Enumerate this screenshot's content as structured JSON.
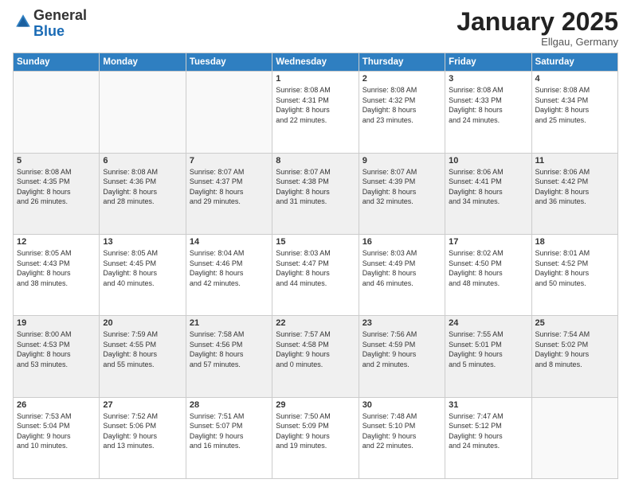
{
  "header": {
    "logo_line1": "General",
    "logo_line2": "Blue",
    "month": "January 2025",
    "location": "Ellgau, Germany"
  },
  "weekdays": [
    "Sunday",
    "Monday",
    "Tuesday",
    "Wednesday",
    "Thursday",
    "Friday",
    "Saturday"
  ],
  "weeks": [
    [
      {
        "day": "",
        "text": ""
      },
      {
        "day": "",
        "text": ""
      },
      {
        "day": "",
        "text": ""
      },
      {
        "day": "1",
        "text": "Sunrise: 8:08 AM\nSunset: 4:31 PM\nDaylight: 8 hours\nand 22 minutes."
      },
      {
        "day": "2",
        "text": "Sunrise: 8:08 AM\nSunset: 4:32 PM\nDaylight: 8 hours\nand 23 minutes."
      },
      {
        "day": "3",
        "text": "Sunrise: 8:08 AM\nSunset: 4:33 PM\nDaylight: 8 hours\nand 24 minutes."
      },
      {
        "day": "4",
        "text": "Sunrise: 8:08 AM\nSunset: 4:34 PM\nDaylight: 8 hours\nand 25 minutes."
      }
    ],
    [
      {
        "day": "5",
        "text": "Sunrise: 8:08 AM\nSunset: 4:35 PM\nDaylight: 8 hours\nand 26 minutes."
      },
      {
        "day": "6",
        "text": "Sunrise: 8:08 AM\nSunset: 4:36 PM\nDaylight: 8 hours\nand 28 minutes."
      },
      {
        "day": "7",
        "text": "Sunrise: 8:07 AM\nSunset: 4:37 PM\nDaylight: 8 hours\nand 29 minutes."
      },
      {
        "day": "8",
        "text": "Sunrise: 8:07 AM\nSunset: 4:38 PM\nDaylight: 8 hours\nand 31 minutes."
      },
      {
        "day": "9",
        "text": "Sunrise: 8:07 AM\nSunset: 4:39 PM\nDaylight: 8 hours\nand 32 minutes."
      },
      {
        "day": "10",
        "text": "Sunrise: 8:06 AM\nSunset: 4:41 PM\nDaylight: 8 hours\nand 34 minutes."
      },
      {
        "day": "11",
        "text": "Sunrise: 8:06 AM\nSunset: 4:42 PM\nDaylight: 8 hours\nand 36 minutes."
      }
    ],
    [
      {
        "day": "12",
        "text": "Sunrise: 8:05 AM\nSunset: 4:43 PM\nDaylight: 8 hours\nand 38 minutes."
      },
      {
        "day": "13",
        "text": "Sunrise: 8:05 AM\nSunset: 4:45 PM\nDaylight: 8 hours\nand 40 minutes."
      },
      {
        "day": "14",
        "text": "Sunrise: 8:04 AM\nSunset: 4:46 PM\nDaylight: 8 hours\nand 42 minutes."
      },
      {
        "day": "15",
        "text": "Sunrise: 8:03 AM\nSunset: 4:47 PM\nDaylight: 8 hours\nand 44 minutes."
      },
      {
        "day": "16",
        "text": "Sunrise: 8:03 AM\nSunset: 4:49 PM\nDaylight: 8 hours\nand 46 minutes."
      },
      {
        "day": "17",
        "text": "Sunrise: 8:02 AM\nSunset: 4:50 PM\nDaylight: 8 hours\nand 48 minutes."
      },
      {
        "day": "18",
        "text": "Sunrise: 8:01 AM\nSunset: 4:52 PM\nDaylight: 8 hours\nand 50 minutes."
      }
    ],
    [
      {
        "day": "19",
        "text": "Sunrise: 8:00 AM\nSunset: 4:53 PM\nDaylight: 8 hours\nand 53 minutes."
      },
      {
        "day": "20",
        "text": "Sunrise: 7:59 AM\nSunset: 4:55 PM\nDaylight: 8 hours\nand 55 minutes."
      },
      {
        "day": "21",
        "text": "Sunrise: 7:58 AM\nSunset: 4:56 PM\nDaylight: 8 hours\nand 57 minutes."
      },
      {
        "day": "22",
        "text": "Sunrise: 7:57 AM\nSunset: 4:58 PM\nDaylight: 9 hours\nand 0 minutes."
      },
      {
        "day": "23",
        "text": "Sunrise: 7:56 AM\nSunset: 4:59 PM\nDaylight: 9 hours\nand 2 minutes."
      },
      {
        "day": "24",
        "text": "Sunrise: 7:55 AM\nSunset: 5:01 PM\nDaylight: 9 hours\nand 5 minutes."
      },
      {
        "day": "25",
        "text": "Sunrise: 7:54 AM\nSunset: 5:02 PM\nDaylight: 9 hours\nand 8 minutes."
      }
    ],
    [
      {
        "day": "26",
        "text": "Sunrise: 7:53 AM\nSunset: 5:04 PM\nDaylight: 9 hours\nand 10 minutes."
      },
      {
        "day": "27",
        "text": "Sunrise: 7:52 AM\nSunset: 5:06 PM\nDaylight: 9 hours\nand 13 minutes."
      },
      {
        "day": "28",
        "text": "Sunrise: 7:51 AM\nSunset: 5:07 PM\nDaylight: 9 hours\nand 16 minutes."
      },
      {
        "day": "29",
        "text": "Sunrise: 7:50 AM\nSunset: 5:09 PM\nDaylight: 9 hours\nand 19 minutes."
      },
      {
        "day": "30",
        "text": "Sunrise: 7:48 AM\nSunset: 5:10 PM\nDaylight: 9 hours\nand 22 minutes."
      },
      {
        "day": "31",
        "text": "Sunrise: 7:47 AM\nSunset: 5:12 PM\nDaylight: 9 hours\nand 24 minutes."
      },
      {
        "day": "",
        "text": ""
      }
    ]
  ]
}
